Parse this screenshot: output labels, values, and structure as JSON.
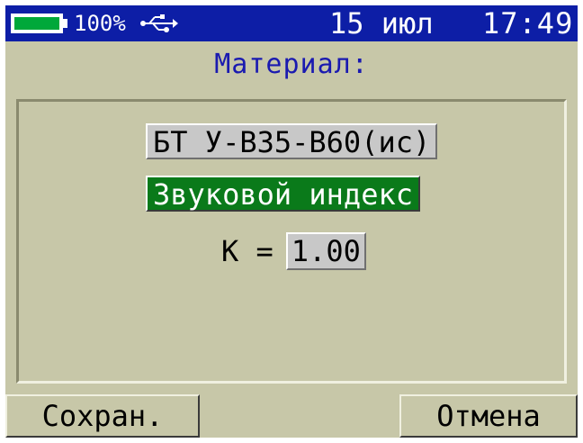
{
  "status": {
    "battery_percent": 100,
    "battery_label": "100%",
    "usb_icon": "usb-icon",
    "date": "15 июл",
    "time": "17:49",
    "colors": {
      "bar": "#0d1ea6",
      "battery_fill": "#00a83a"
    }
  },
  "title": "Материал:",
  "material": {
    "value": "БТ У-В35-В60(ис)"
  },
  "mode": {
    "value": "Звуковой индекс"
  },
  "coefficient": {
    "label": "K =",
    "value": "1.00"
  },
  "softkeys": {
    "save": "Сохран.",
    "cancel": "Отмена"
  }
}
